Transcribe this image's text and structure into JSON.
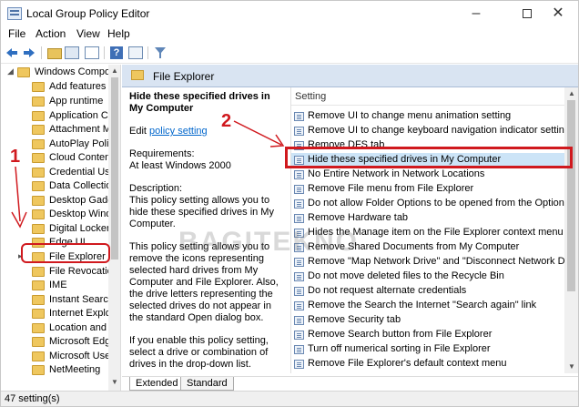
{
  "window": {
    "title": "Local Group Policy Editor"
  },
  "menu": [
    "File",
    "Action",
    "View",
    "Help"
  ],
  "tree": {
    "root": "Windows Compon",
    "items": [
      "Add features t",
      "App runtime",
      "Application C",
      "Attachment M",
      "AutoPlay Polic",
      "Cloud Conten",
      "Credential Use",
      "Data Collectio",
      "Desktop Gadg",
      "Desktop Wind",
      "Digital Locker",
      "Edge UI",
      "File Explorer",
      "File Revocatio",
      "IME",
      "Instant Search",
      "Internet Explor",
      "Location and S",
      "Microsoft Edg",
      "Microsoft Use",
      "NetMeeting"
    ]
  },
  "header": {
    "title": "File Explorer"
  },
  "description": {
    "policy_title": "Hide these specified drives in My Computer",
    "edit_prefix": "Edit",
    "edit_link": "policy setting",
    "requirements_label": "Requirements:",
    "requirements_value": "At least Windows 2000",
    "desc_label": "Description:",
    "para1": "This policy setting allows you to hide these specified drives in My Computer.",
    "para2": "This policy setting allows you to remove the icons representing selected hard drives from My Computer and File Explorer. Also, the drive letters representing the selected drives do not appear in the standard Open dialog box.",
    "para3": "If you enable this policy setting, select a drive or combination of drives in the drop-down list."
  },
  "list": {
    "column": "Setting",
    "rows": [
      "Remove UI to change menu animation setting",
      "Remove UI to change keyboard navigation indicator setting",
      "Remove DFS tab",
      "Hide these specified drives in My Computer",
      "No Entire Network in Network Locations",
      "Remove File menu from File Explorer",
      "Do not allow Folder Options to be opened from the Options...",
      "Remove Hardware tab",
      "Hides the Manage item on the File Explorer context menu",
      "Remove Shared Documents from My Computer",
      "Remove \"Map Network Drive\" and \"Disconnect Network Dri...",
      "Do not move deleted files to the Recycle Bin",
      "Do not request alternate credentials",
      "Remove the Search the Internet \"Search again\" link",
      "Remove Security tab",
      "Remove Search button from File Explorer",
      "Turn off numerical sorting in File Explorer",
      "Remove File Explorer's default context menu"
    ]
  },
  "tabs": [
    "Extended",
    "Standard"
  ],
  "status": "47 setting(s)",
  "annotations": {
    "step1": "1",
    "step2": "2",
    "watermark": "BAGITEKNO"
  },
  "colors": {
    "accent": "#d0191e",
    "header": "#d9e4f2",
    "selection": "#cce4f7"
  }
}
